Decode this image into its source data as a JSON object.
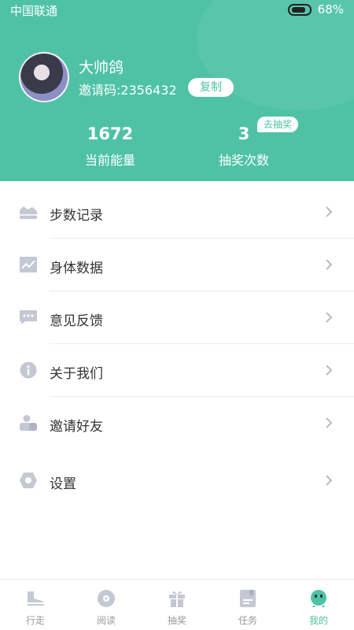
{
  "status_bar": {
    "carrier": "中国联通",
    "battery_percent": "68%"
  },
  "profile": {
    "username": "大帅鸽",
    "invite_code": "邀请码:2356432",
    "copy_label": "复制"
  },
  "stats": {
    "energy": {
      "value": "1672",
      "label": "当前能量"
    },
    "draws": {
      "value": "3",
      "label": "抽奖次数",
      "action_label": "去抽奖"
    }
  },
  "menu": [
    {
      "label": "步数记录",
      "icon": "steps-record-icon"
    },
    {
      "label": "身体数据",
      "icon": "chart-line-icon"
    },
    {
      "label": "意见反馈",
      "icon": "chat-bubble-icon"
    },
    {
      "label": "关于我们",
      "icon": "info-icon"
    },
    {
      "label": "邀请好友",
      "icon": "people-icon"
    },
    {
      "label": "设置",
      "icon": "hexagon-settings-icon"
    }
  ],
  "tabs": [
    {
      "label": "行走",
      "icon": "shoe-icon",
      "active": false
    },
    {
      "label": "阅读",
      "icon": "disc-icon",
      "active": false
    },
    {
      "label": "抽奖",
      "icon": "gift-icon",
      "active": false
    },
    {
      "label": "任务",
      "icon": "task-icon",
      "active": false
    },
    {
      "label": "我的",
      "icon": "robot-face-icon",
      "active": true
    }
  ],
  "colors": {
    "accent": "#4fc2a6",
    "icon_gray": "#c3c8d3",
    "text": "#333333",
    "muted": "#999999"
  }
}
